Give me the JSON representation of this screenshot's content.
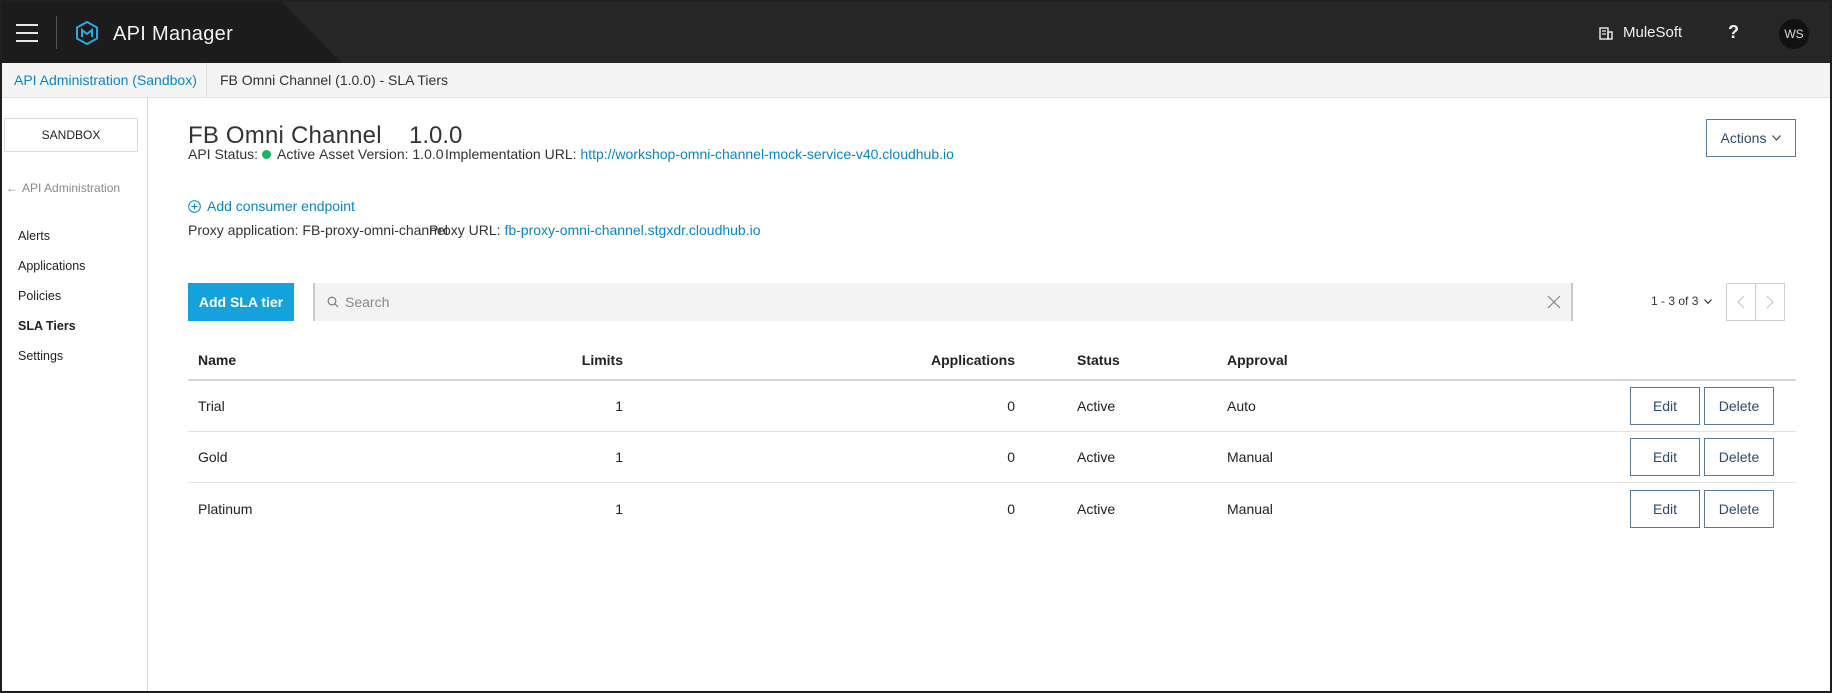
{
  "header": {
    "app_title": "API Manager",
    "org_name": "MuleSoft",
    "help_label": "?",
    "user_initials": "WS"
  },
  "breadcrumb": {
    "parent": "API Administration (Sandbox)",
    "current": "FB Omni Channel (1.0.0) - SLA Tiers"
  },
  "sidebar": {
    "environment": "SANDBOX",
    "back_label": "API Administration",
    "items": [
      {
        "label": "Alerts",
        "active": false
      },
      {
        "label": "Applications",
        "active": false
      },
      {
        "label": "Policies",
        "active": false
      },
      {
        "label": "SLA Tiers",
        "active": true
      },
      {
        "label": "Settings",
        "active": false
      }
    ]
  },
  "api": {
    "name": "FB Omni Channel",
    "version": "1.0.0",
    "status_label": "API Status:",
    "status_value": "Active",
    "asset_version_label": "Asset Version:",
    "asset_version_value": "1.0.0",
    "impl_url_label": "Implementation URL:",
    "impl_url_value": "http://workshop-omni-channel-mock-service-v40.cloudhub.io",
    "add_endpoint_label": "Add consumer endpoint",
    "proxy_app_label": "Proxy application:",
    "proxy_app_value": "FB-proxy-omni-channel",
    "proxy_url_label": "Proxy URL:",
    "proxy_url_value": "fb-proxy-omni-channel.stgxdr.cloudhub.io",
    "actions_label": "Actions"
  },
  "toolbar": {
    "add_sla_label": "Add SLA tier",
    "search_placeholder": "Search",
    "search_value": "",
    "pager_text": "1 - 3 of 3"
  },
  "table": {
    "columns": [
      "Name",
      "Limits",
      "Applications",
      "Status",
      "Approval"
    ],
    "rows": [
      {
        "name": "Trial",
        "limits": "1",
        "applications": "0",
        "status": "Active",
        "approval": "Auto"
      },
      {
        "name": "Gold",
        "limits": "1",
        "applications": "0",
        "status": "Active",
        "approval": "Manual"
      },
      {
        "name": "Platinum",
        "limits": "1",
        "applications": "0",
        "status": "Active",
        "approval": "Manual"
      }
    ],
    "edit_label": "Edit",
    "delete_label": "Delete"
  },
  "colors": {
    "accent": "#13a2db",
    "link": "#0a86c7",
    "status_active": "#19b35e",
    "topbar": "#262626"
  }
}
